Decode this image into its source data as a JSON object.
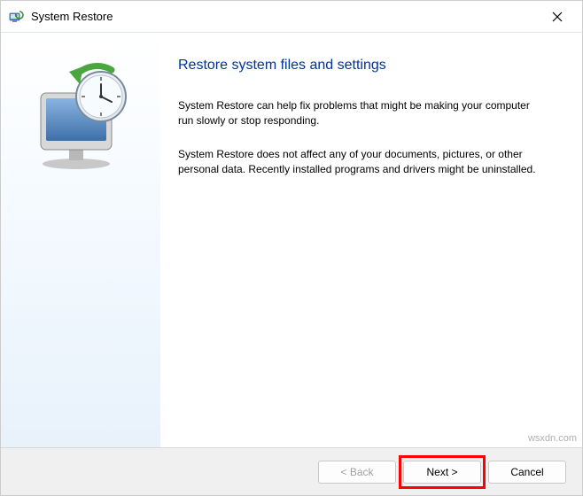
{
  "titlebar": {
    "title": "System Restore"
  },
  "main": {
    "heading": "Restore system files and settings",
    "para1": "System Restore can help fix problems that might be making your computer run slowly or stop responding.",
    "para2": "System Restore does not affect any of your documents, pictures, or other personal data. Recently installed programs and drivers might be uninstalled."
  },
  "footer": {
    "back_label": "< Back",
    "next_label": "Next >",
    "cancel_label": "Cancel"
  },
  "watermark": "wsxdn.com"
}
